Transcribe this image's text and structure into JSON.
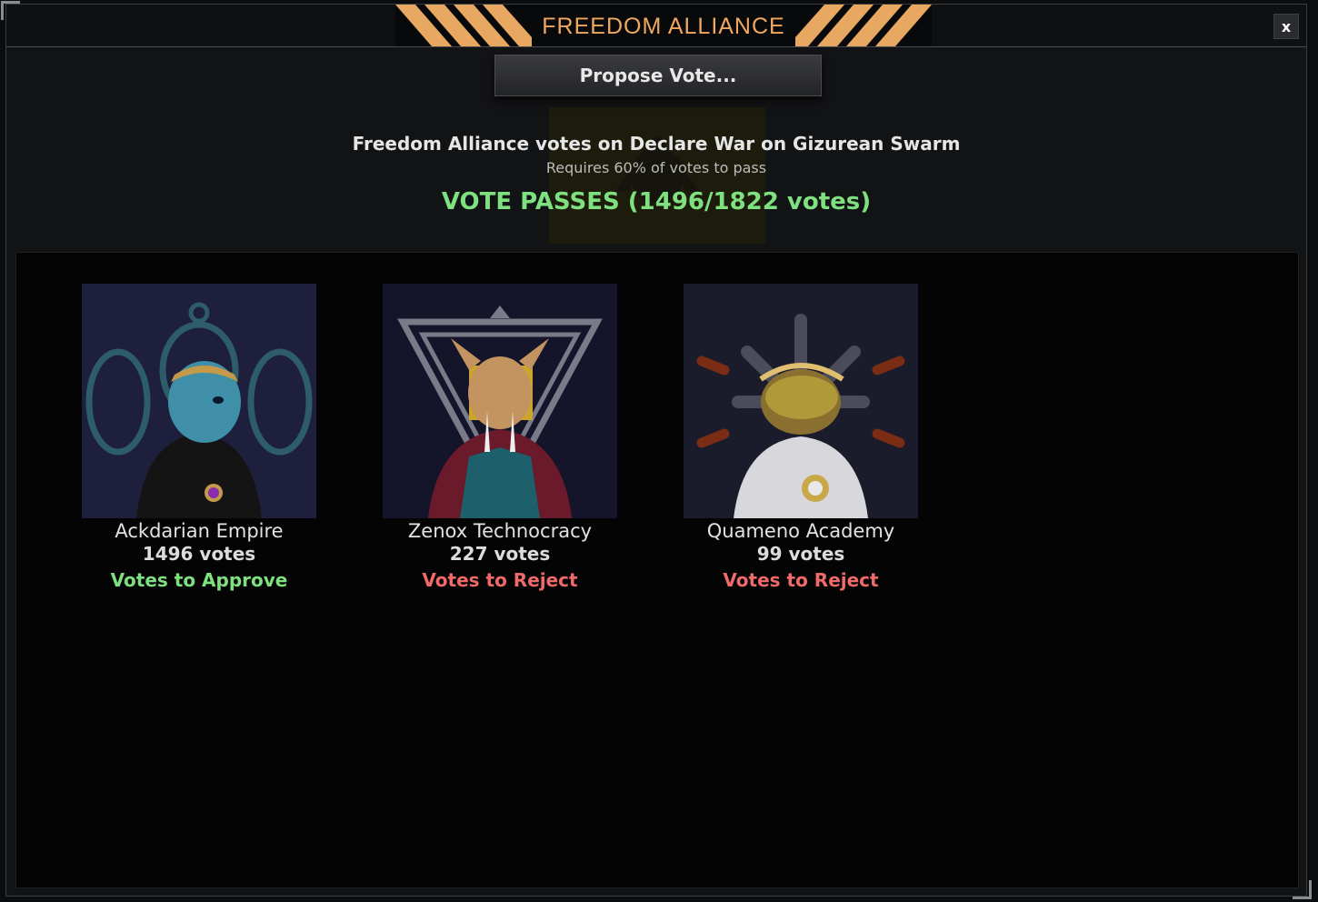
{
  "window": {
    "title": "FREEDOM ALLIANCE",
    "close_label": "x",
    "accent_color": "#f0a860"
  },
  "toolbar": {
    "propose_label": "Propose Vote..."
  },
  "vote": {
    "title": "Freedom Alliance votes on Declare War on Gizurean Swarm",
    "requirement": "Requires 60% of votes to pass",
    "result": "VOTE PASSES (1496/1822 votes)",
    "result_color": "#7ee07e"
  },
  "factions": [
    {
      "name": "Ackdarian Empire",
      "votes": "1496 votes",
      "stance": "Votes to Approve",
      "stance_type": "approve"
    },
    {
      "name": "Zenox Technocracy",
      "votes": "227 votes",
      "stance": "Votes to Reject",
      "stance_type": "reject"
    },
    {
      "name": "Quameno Academy",
      "votes": "99 votes",
      "stance": "Votes to Reject",
      "stance_type": "reject"
    }
  ],
  "icons": {
    "close": "close-icon",
    "faction_emblem": "alliance-emblem-icon"
  }
}
